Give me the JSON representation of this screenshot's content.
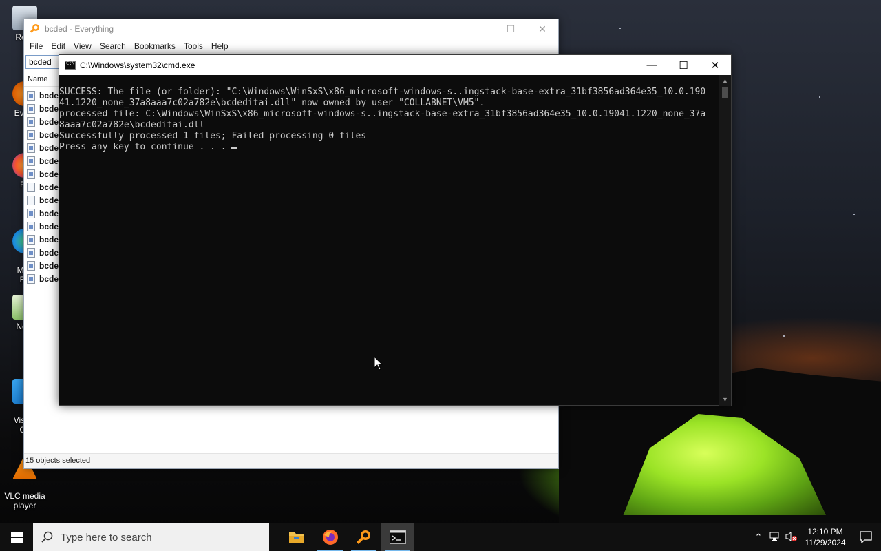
{
  "desktop": {
    "icons": [
      {
        "label": "Recy"
      },
      {
        "label": "Every"
      },
      {
        "label": "Fir"
      },
      {
        "label": "Micr\nEd"
      },
      {
        "label": "Note"
      },
      {
        "label": "Visual\nCo"
      },
      {
        "label": "VLC media\nplayer"
      }
    ]
  },
  "everything": {
    "title": "bcded - Everything",
    "menu": [
      "File",
      "Edit",
      "View",
      "Search",
      "Bookmarks",
      "Tools",
      "Help"
    ],
    "search_value": "bcded",
    "column_name": "Name",
    "rows": [
      "bcde",
      "bcde",
      "bcde",
      "bcde",
      "bcde",
      "bcde",
      "bcde",
      "bcde",
      "bcde",
      "bcde",
      "bcde",
      "bcde",
      "bcde",
      "bcde",
      "bcde"
    ],
    "status": "15 objects selected"
  },
  "cmd": {
    "title": "C:\\Windows\\system32\\cmd.exe",
    "lines": [
      "SUCCESS: The file (or folder): \"C:\\Windows\\WinSxS\\x86_microsoft-windows-s..ingstack-base-extra_31bf3856ad364e35_10.0.190",
      "41.1220_none_37a8aaa7c02a782e\\bcdeditai.dll\" now owned by user \"COLLABNET\\VM5\".",
      "processed file: C:\\Windows\\WinSxS\\x86_microsoft-windows-s..ingstack-base-extra_31bf3856ad364e35_10.0.19041.1220_none_37a",
      "8aaa7c02a782e\\bcdeditai.dll",
      "Successfully processed 1 files; Failed processing 0 files",
      "Press any key to continue . . . "
    ]
  },
  "taskbar": {
    "search_placeholder": "Type here to search",
    "time": "12:10 PM",
    "date": "11/29/2024"
  },
  "colors": {
    "cmd_bg": "#0c0c0c",
    "cmd_text": "#cccccc",
    "taskbar_bg": "#101010",
    "active_underline": "#76b9ed"
  }
}
